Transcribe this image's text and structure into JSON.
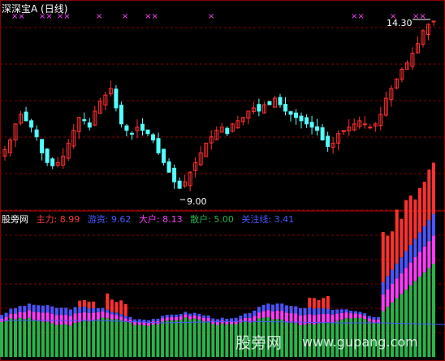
{
  "title": "深深宝A (日线)",
  "price_annotations": {
    "high": "14.30",
    "low": "9.00"
  },
  "indicator": {
    "brand": "股旁网",
    "items": [
      {
        "label": "主力:",
        "value": "8.99",
        "color": "#ff3a3a"
      },
      {
        "label": "游资:",
        "value": "9.62",
        "color": "#4a55ff"
      },
      {
        "label": "大户:",
        "value": "8.13",
        "color": "#ff3aff"
      },
      {
        "label": "散户:",
        "value": "5.00",
        "color": "#2bb34a"
      },
      {
        "label": "关注线:",
        "value": "3.41",
        "color": "#4a55ff"
      }
    ]
  },
  "watermark": {
    "brand": "股旁网",
    "url": "www.gupang.com"
  },
  "colors": {
    "up": "#ff3030",
    "down": "#54ffff",
    "grid": "#8a0000",
    "signal": "#ff44ff"
  },
  "signal_marks": [
    "××",
    "××",
    "××",
    "×",
    "×",
    "××",
    "×",
    "××",
    "×",
    "××"
  ],
  "chart_data": [
    {
      "type": "line",
      "title": "",
      "series": [
        {
          "values": [
            10.3,
            10.6,
            11.1,
            11.4,
            11.2,
            11.0,
            10.7,
            10.2,
            9.9,
            9.8,
            9.9,
            10.1,
            10.5,
            10.9,
            11.3,
            11.2,
            11.0,
            11.5,
            11.8,
            12.0,
            12.2,
            11.6,
            11.1,
            10.9,
            10.8,
            11.0,
            10.9,
            10.8,
            10.6,
            10.2,
            9.9,
            9.6,
            9.3,
            9.1,
            9.3,
            9.6,
            9.9,
            10.2,
            10.5,
            10.7,
            10.9,
            11.0,
            10.8,
            11.1,
            11.2,
            11.3,
            11.5,
            11.6,
            11.5,
            11.7,
            11.7,
            11.9,
            11.7,
            11.5,
            11.4,
            11.3,
            11.2,
            11.1,
            11.0,
            10.9,
            10.6,
            10.4,
            10.5,
            10.8,
            10.9,
            11.0,
            11.1,
            11.2,
            11.1,
            11.0,
            11.1,
            11.4,
            11.9,
            12.2,
            12.5,
            12.8,
            13.0,
            13.3,
            13.6,
            14.0,
            14.2,
            14.3
          ]
        }
      ]
    },
    {
      "type": "bar",
      "title": "",
      "series": [
        {
          "name": "主力",
          "values": [
            8.99
          ]
        },
        {
          "name": "游资",
          "values": [
            9.62
          ]
        },
        {
          "name": "大户",
          "values": [
            8.13
          ]
        },
        {
          "name": "散户",
          "values": [
            5.0
          ]
        },
        {
          "name": "关注线",
          "values": [
            3.41
          ]
        }
      ]
    }
  ]
}
